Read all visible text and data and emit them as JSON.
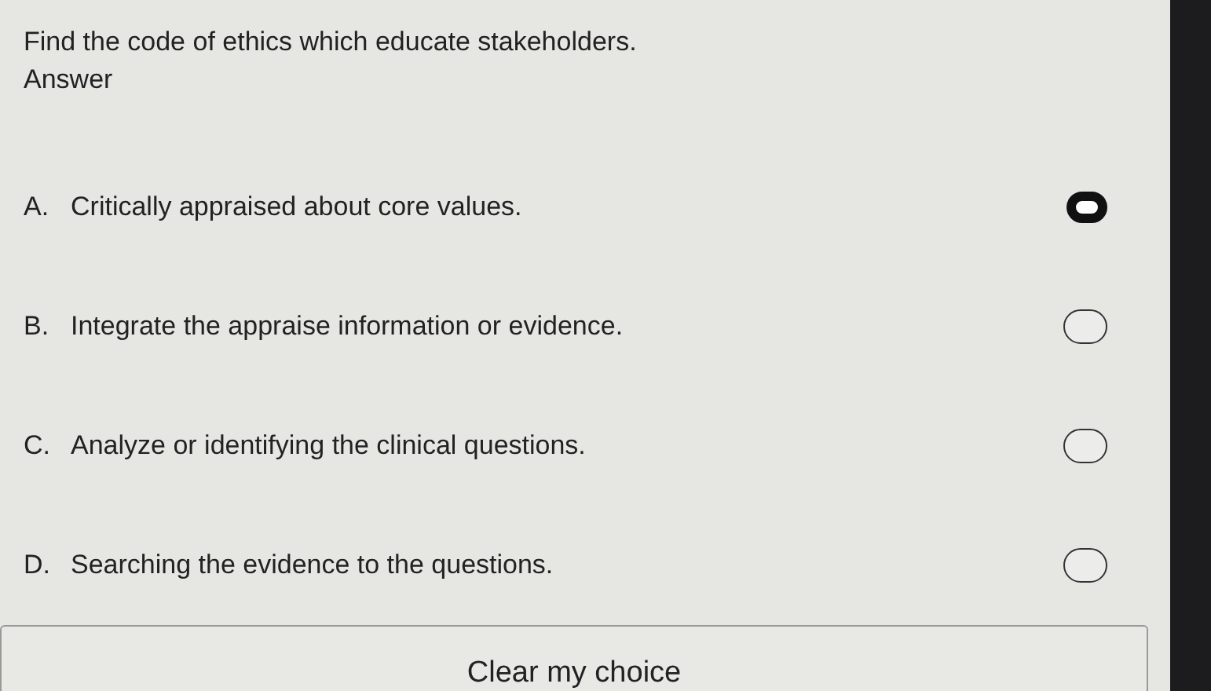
{
  "question": "Find the code of ethics which educate stakeholders.",
  "answer_label": "Answer",
  "options": [
    {
      "letter": "A.",
      "text": "Critically appraised about core values.",
      "selected": true
    },
    {
      "letter": "B.",
      "text": "Integrate the appraise information or evidence.",
      "selected": false
    },
    {
      "letter": "C.",
      "text": "Analyze or identifying the clinical questions.",
      "selected": false
    },
    {
      "letter": "D.",
      "text": "Searching the evidence to the questions.",
      "selected": false
    }
  ],
  "clear_button": "Clear my choice"
}
